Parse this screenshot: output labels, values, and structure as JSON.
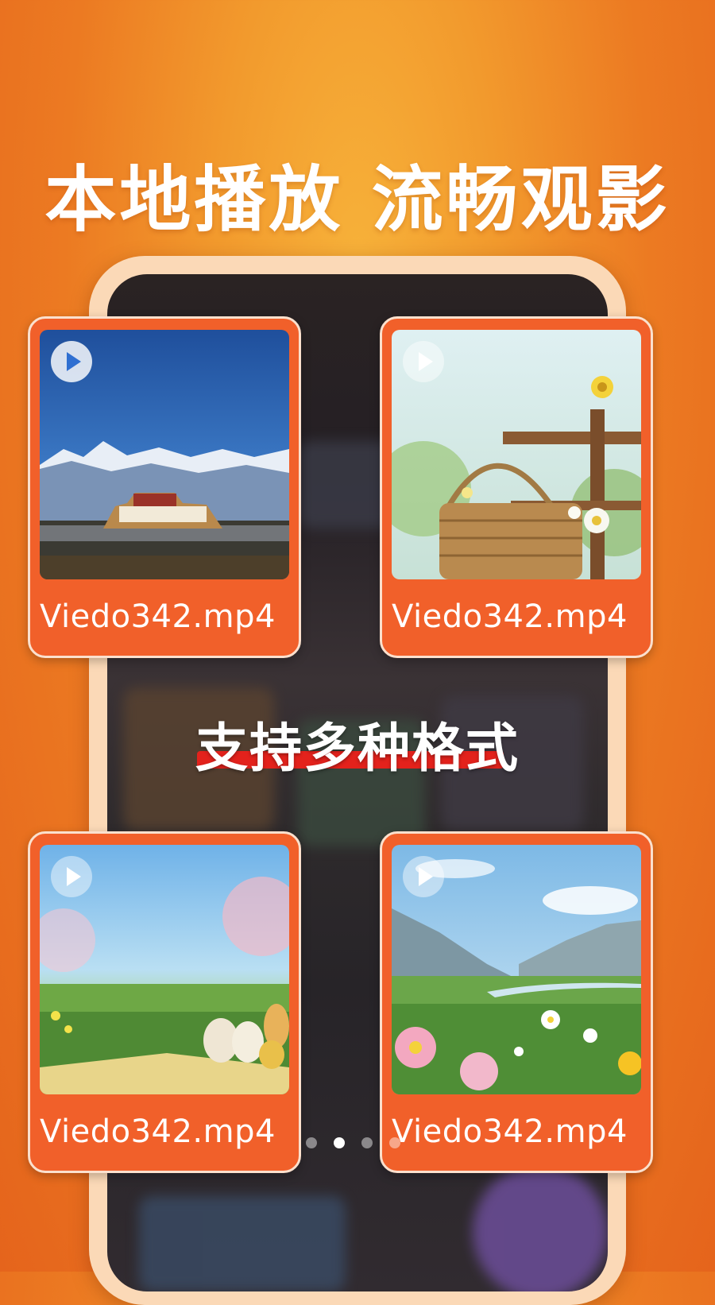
{
  "headline": "本地播放 流畅观影",
  "subtitle": "支持多种格式",
  "videos": [
    {
      "filename": "Viedo342.mp4",
      "scene": "palace-mountains"
    },
    {
      "filename": "Viedo342.mp4",
      "scene": "basket-flowers"
    },
    {
      "filename": "Viedo342.mp4",
      "scene": "easter-eggs-meadow"
    },
    {
      "filename": "Viedo342.mp4",
      "scene": "valley-flowers"
    }
  ],
  "pagination": {
    "count": 4,
    "active_index": 1
  },
  "colors": {
    "background": "#ec7a22",
    "card": "#f1602a",
    "card_border": "#fbe0cd",
    "phone_frame": "#fbd9b7",
    "underline": "#e3221c"
  },
  "icons": {
    "play": "play-circle-icon"
  }
}
